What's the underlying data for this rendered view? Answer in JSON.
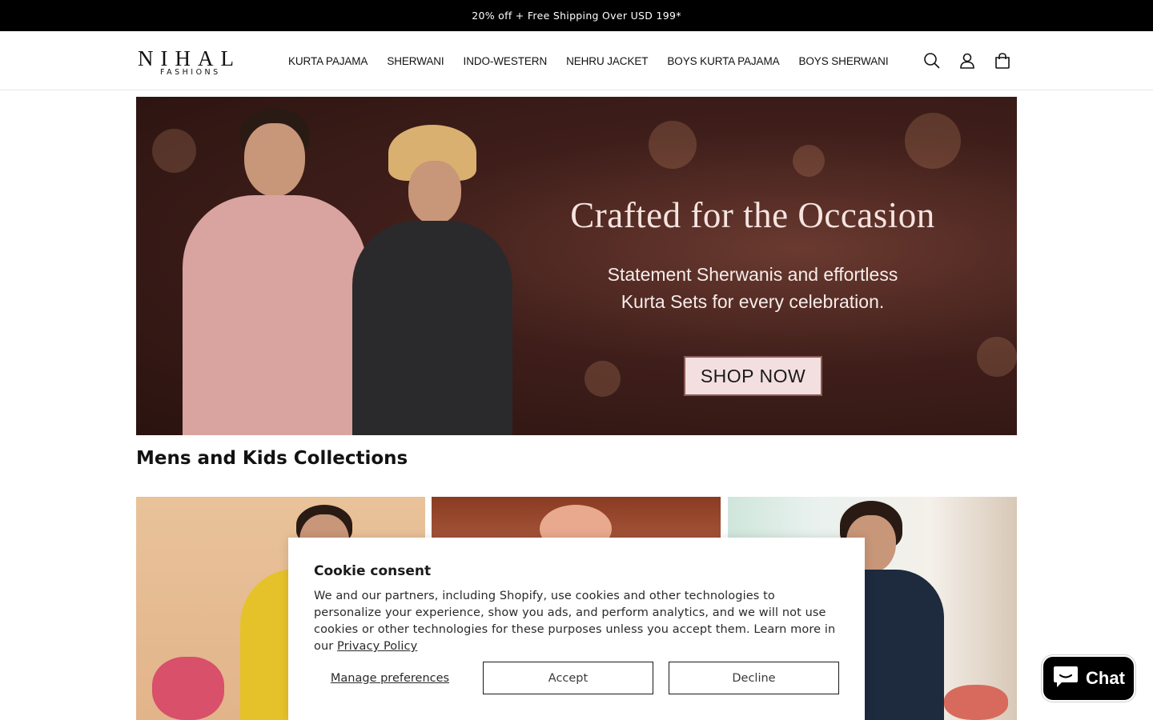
{
  "announcement": {
    "text": "20% off + Free Shipping Over USD 199*"
  },
  "header": {
    "logo": {
      "primary": "NIHAL",
      "secondary": "FASHIONS"
    },
    "nav": [
      {
        "label": "KURTA PAJAMA"
      },
      {
        "label": "SHERWANI"
      },
      {
        "label": "INDO-WESTERN"
      },
      {
        "label": "NEHRU JACKET"
      },
      {
        "label": "BOYS KURTA PAJAMA"
      },
      {
        "label": "BOYS SHERWANI"
      }
    ],
    "icons": [
      "search-icon",
      "account-icon",
      "cart-icon"
    ]
  },
  "hero": {
    "title": "Crafted for the Occasion",
    "subtitle_line1": "Statement Sherwanis and effortless",
    "subtitle_line2": "Kurta Sets for every celebration.",
    "cta": "SHOP NOW"
  },
  "collections": {
    "title": "Mens and Kids Collections"
  },
  "cookie_consent": {
    "title": "Cookie consent",
    "body": "We and our partners, including Shopify, use cookies and other technologies to personalize your experience, show you ads, and perform analytics, and we will not use cookies or other technologies for these purposes unless you accept them. Learn more in our ",
    "link": "Privacy Policy",
    "manage": "Manage preferences",
    "accept": "Accept",
    "decline": "Decline"
  },
  "chat": {
    "label": "Chat",
    "icon": "chat-bubble-icon"
  }
}
